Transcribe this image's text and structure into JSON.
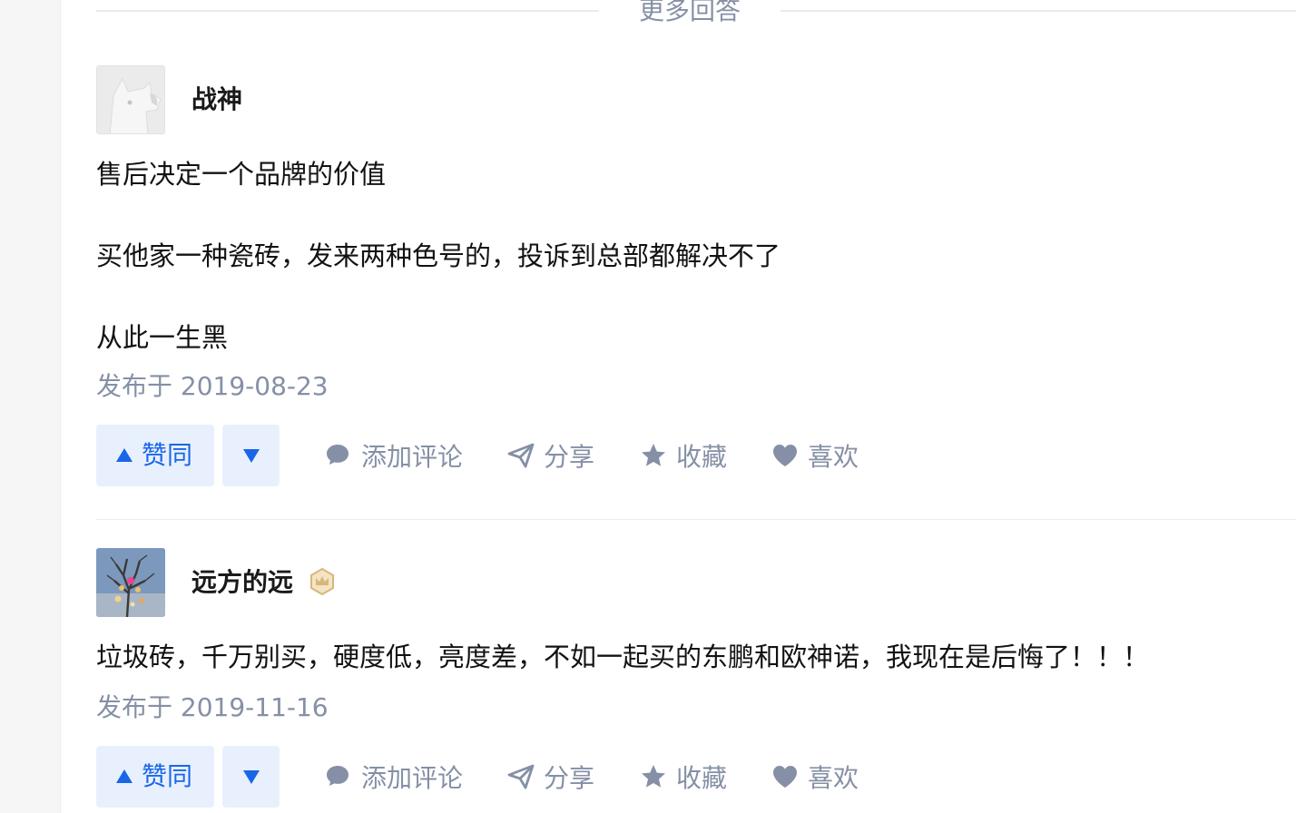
{
  "divider": {
    "label": "更多回答"
  },
  "answers": [
    {
      "author": {
        "name": "战神",
        "avatar": "default-avatar",
        "badge": null
      },
      "paragraphs": [
        "售后决定一个品牌的价值",
        "买他家一种瓷砖，发来两种色号的，投诉到总部都解决不了",
        "从此一生黑"
      ],
      "date": "发布于 2019-08-23",
      "actions": {
        "upvote": "赞同",
        "comment": "添加评论",
        "share": "分享",
        "favorite": "收藏",
        "like": "喜欢"
      }
    },
    {
      "author": {
        "name": "远方的远",
        "avatar": "tree-photo-avatar",
        "badge": "crown-badge-icon"
      },
      "paragraphs": [
        "垃圾砖，千万别买，硬度低，亮度差，不如一起买的东鹏和欧神诺，我现在是后悔了！！！"
      ],
      "date": "发布于 2019-11-16",
      "actions": {
        "upvote": "赞同",
        "comment": "添加评论",
        "share": "分享",
        "favorite": "收藏",
        "like": "喜欢"
      }
    }
  ],
  "colors": {
    "accent": "#1966e8",
    "accent_bg": "#e8f0fd",
    "muted": "#8590a6",
    "text": "#121212",
    "badge": "#d9b77a"
  }
}
